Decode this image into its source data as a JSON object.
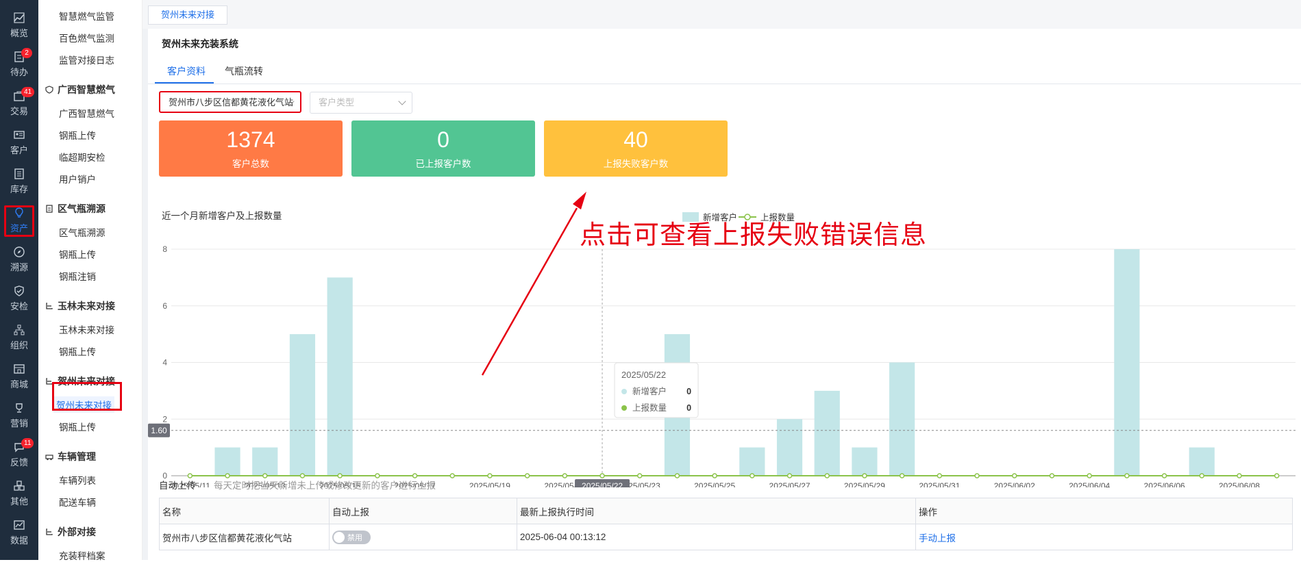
{
  "rail": [
    {
      "label": "概览",
      "icon": "chart-icon"
    },
    {
      "label": "待办",
      "icon": "todo-icon",
      "badge": "2"
    },
    {
      "label": "交易",
      "icon": "trade-icon",
      "badge": "41"
    },
    {
      "label": "客户",
      "icon": "customer-card-icon"
    },
    {
      "label": "库存",
      "icon": "inventory-icon"
    },
    {
      "label": "资产",
      "icon": "bulb-icon",
      "active": true
    },
    {
      "label": "溯源",
      "icon": "compass-icon"
    },
    {
      "label": "安检",
      "icon": "shield-check-icon"
    },
    {
      "label": "组织",
      "icon": "org-icon"
    },
    {
      "label": "商城",
      "icon": "shop-icon"
    },
    {
      "label": "营销",
      "icon": "trophy-icon"
    },
    {
      "label": "反馈",
      "icon": "feedback-icon",
      "badge": "11"
    },
    {
      "label": "其他",
      "icon": "apps-icon"
    },
    {
      "label": "数据",
      "icon": "data-icon"
    }
  ],
  "sidebar": {
    "pre_items": [
      "智慧燃气监管",
      "百色燃气监测",
      "监管对接日志"
    ],
    "groups": [
      {
        "title": "广西智慧燃气",
        "icon": "shield-icon",
        "items": [
          "广西智慧燃气",
          "钢瓶上传",
          "临超期安检",
          "用户销户"
        ]
      },
      {
        "title": "区气瓶溯源",
        "icon": "doc-icon",
        "items": [
          "区气瓶溯源",
          "钢瓶上传",
          "钢瓶注销"
        ]
      },
      {
        "title": "玉林未来对接",
        "icon": "link-icon",
        "items": [
          "玉林未来对接",
          "钢瓶上传"
        ]
      },
      {
        "title": "贺州未来对接",
        "icon": "link-icon",
        "items": [
          "贺州未来对接",
          "钢瓶上传"
        ]
      },
      {
        "title": "车辆管理",
        "icon": "car-icon",
        "items": [
          "车辆列表",
          "配送车辆"
        ]
      },
      {
        "title": "外部对接",
        "icon": "link-icon",
        "items": [
          "充装秤档案"
        ]
      }
    ]
  },
  "page_tab": "贺州未来对接",
  "system_title": "贺州未来充装系统",
  "subtabs": [
    "客户资料",
    "气瓶流转"
  ],
  "filters": {
    "station": "贺州市八步区信都黄花液化气站",
    "customer_type_placeholder": "客户类型"
  },
  "cards": [
    {
      "value": "1374",
      "label": "客户总数",
      "color": "#ff7a45"
    },
    {
      "value": "0",
      "label": "已上报客户数",
      "color": "#52c593"
    },
    {
      "value": "40",
      "label": "上报失败客户数",
      "color": "#ffc13d"
    }
  ],
  "annotation": "点击可查看上报失败错误信息",
  "chart_data": {
    "type": "bar",
    "title": "近一个月新增客户及上报数量",
    "legend": [
      "新增客户",
      "上报数量"
    ],
    "legend_position": "top-center",
    "x": [
      "2025/05/11",
      "2025/05/12",
      "2025/05/13",
      "2025/05/14",
      "2025/05/15",
      "2025/05/16",
      "2025/05/17",
      "2025/05/18",
      "2025/05/19",
      "2025/05/20",
      "2025/05/21",
      "2025/05/22",
      "2025/05/23",
      "2025/05/24",
      "2025/05/25",
      "2025/05/26",
      "2025/05/27",
      "2025/05/28",
      "2025/05/29",
      "2025/05/30",
      "2025/05/31",
      "2025/06/01",
      "2025/06/02",
      "2025/06/03",
      "2025/06/04",
      "2025/06/05",
      "2025/06/06",
      "2025/06/07",
      "2025/06/08",
      "2025/06/09"
    ],
    "series": [
      {
        "name": "新增客户",
        "type": "bar",
        "color": "#c3e6e8",
        "values": [
          0,
          1,
          1,
          5,
          7,
          0,
          0,
          0,
          0,
          0,
          0,
          0,
          0,
          5,
          0,
          1,
          2,
          3,
          1,
          4,
          0,
          0,
          0,
          0,
          0,
          8,
          0,
          1,
          0,
          0
        ]
      },
      {
        "name": "上报数量",
        "type": "line",
        "color": "#8bc34a",
        "values": [
          0,
          0,
          0,
          0,
          0,
          0,
          0,
          0,
          0,
          0,
          0,
          0,
          0,
          0,
          0,
          0,
          0,
          0,
          0,
          0,
          0,
          0,
          0,
          0,
          0,
          0,
          0,
          0,
          0,
          0
        ]
      }
    ],
    "ylim": [
      0,
      8
    ],
    "yticks": [
      "0",
      "2",
      "4",
      "6",
      "8"
    ],
    "xticks": [
      "2025/05/11",
      "2025/05/13",
      "2025/05/15",
      "2025/05/17",
      "2025/05/19",
      "2025/05/21",
      "2025/05/23",
      "2025/05/25",
      "2025/05/27",
      "2025/05/29",
      "2025/05/31",
      "2025/06/02",
      "2025/06/04",
      "2025/06/06",
      "2025/06/08"
    ],
    "crosshair": {
      "y_value": 1.6,
      "y_label": "1.60",
      "x_label": "2025/05/22",
      "x_index": 11
    },
    "tooltip": {
      "date": "2025/05/22",
      "rows": [
        {
          "name": "新增客户",
          "value": "0"
        },
        {
          "name": "上报数量",
          "value": "0"
        }
      ]
    }
  },
  "auto_upload": {
    "label": "自动上传",
    "hint": "每天定时把当天新增未上传或修改更新的客户进行上报"
  },
  "table": {
    "headers": [
      "名称",
      "自动上报",
      "最新上报执行时间",
      "操作"
    ],
    "rows": [
      {
        "name": "贺州市八步区信都黄花液化气站",
        "toggle": "禁用",
        "time": "2025-06-04 00:13:12",
        "action": "手动上报"
      }
    ]
  }
}
